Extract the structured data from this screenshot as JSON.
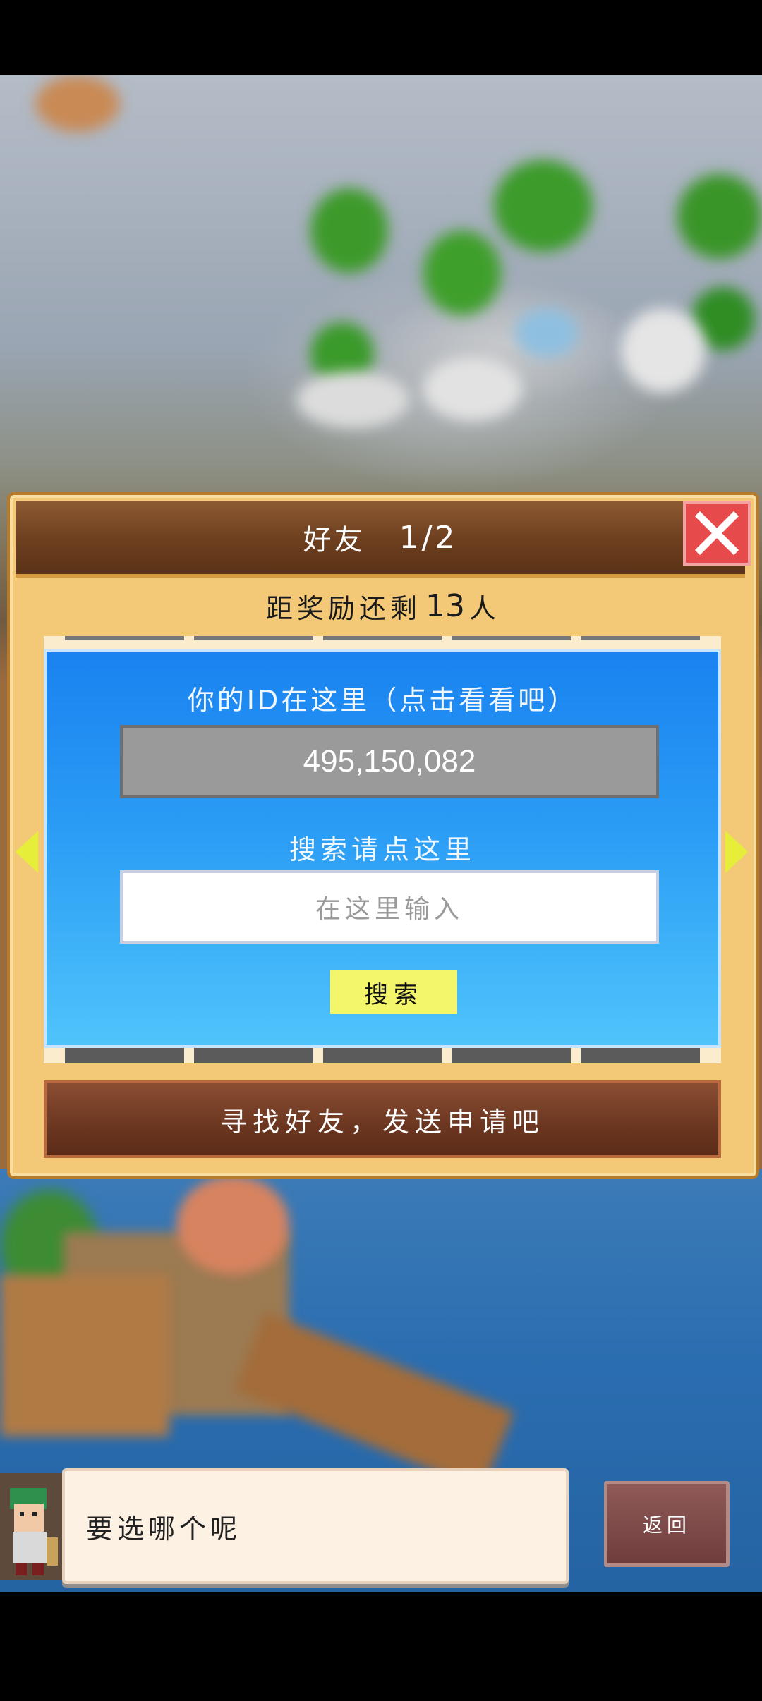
{
  "dialog": {
    "title": "好友",
    "page_indicator": "1/2",
    "reward_prefix": "距奖励还剩",
    "reward_count": "13",
    "reward_suffix": "人",
    "id_label": "你的ID在这里（点击看看吧）",
    "player_id": "495,150,082",
    "search_label": "搜索请点这里",
    "search_placeholder": "在这里输入",
    "search_button": "搜索",
    "find_button": "寻找好友，发送申请吧"
  },
  "footer": {
    "message": "要选哪个呢",
    "back_button": "返回"
  },
  "icons": {
    "close": "close-icon",
    "prev": "arrow-left-icon",
    "next": "arrow-right-icon"
  },
  "colors": {
    "dialog_bg": "#f3c877",
    "header_brown": "#6d3f1f",
    "panel_blue": "#1a82f0",
    "close_red": "#e64a4a",
    "search_button_yellow": "#f3f56a",
    "arrow_yellow": "#e6ee3a"
  }
}
